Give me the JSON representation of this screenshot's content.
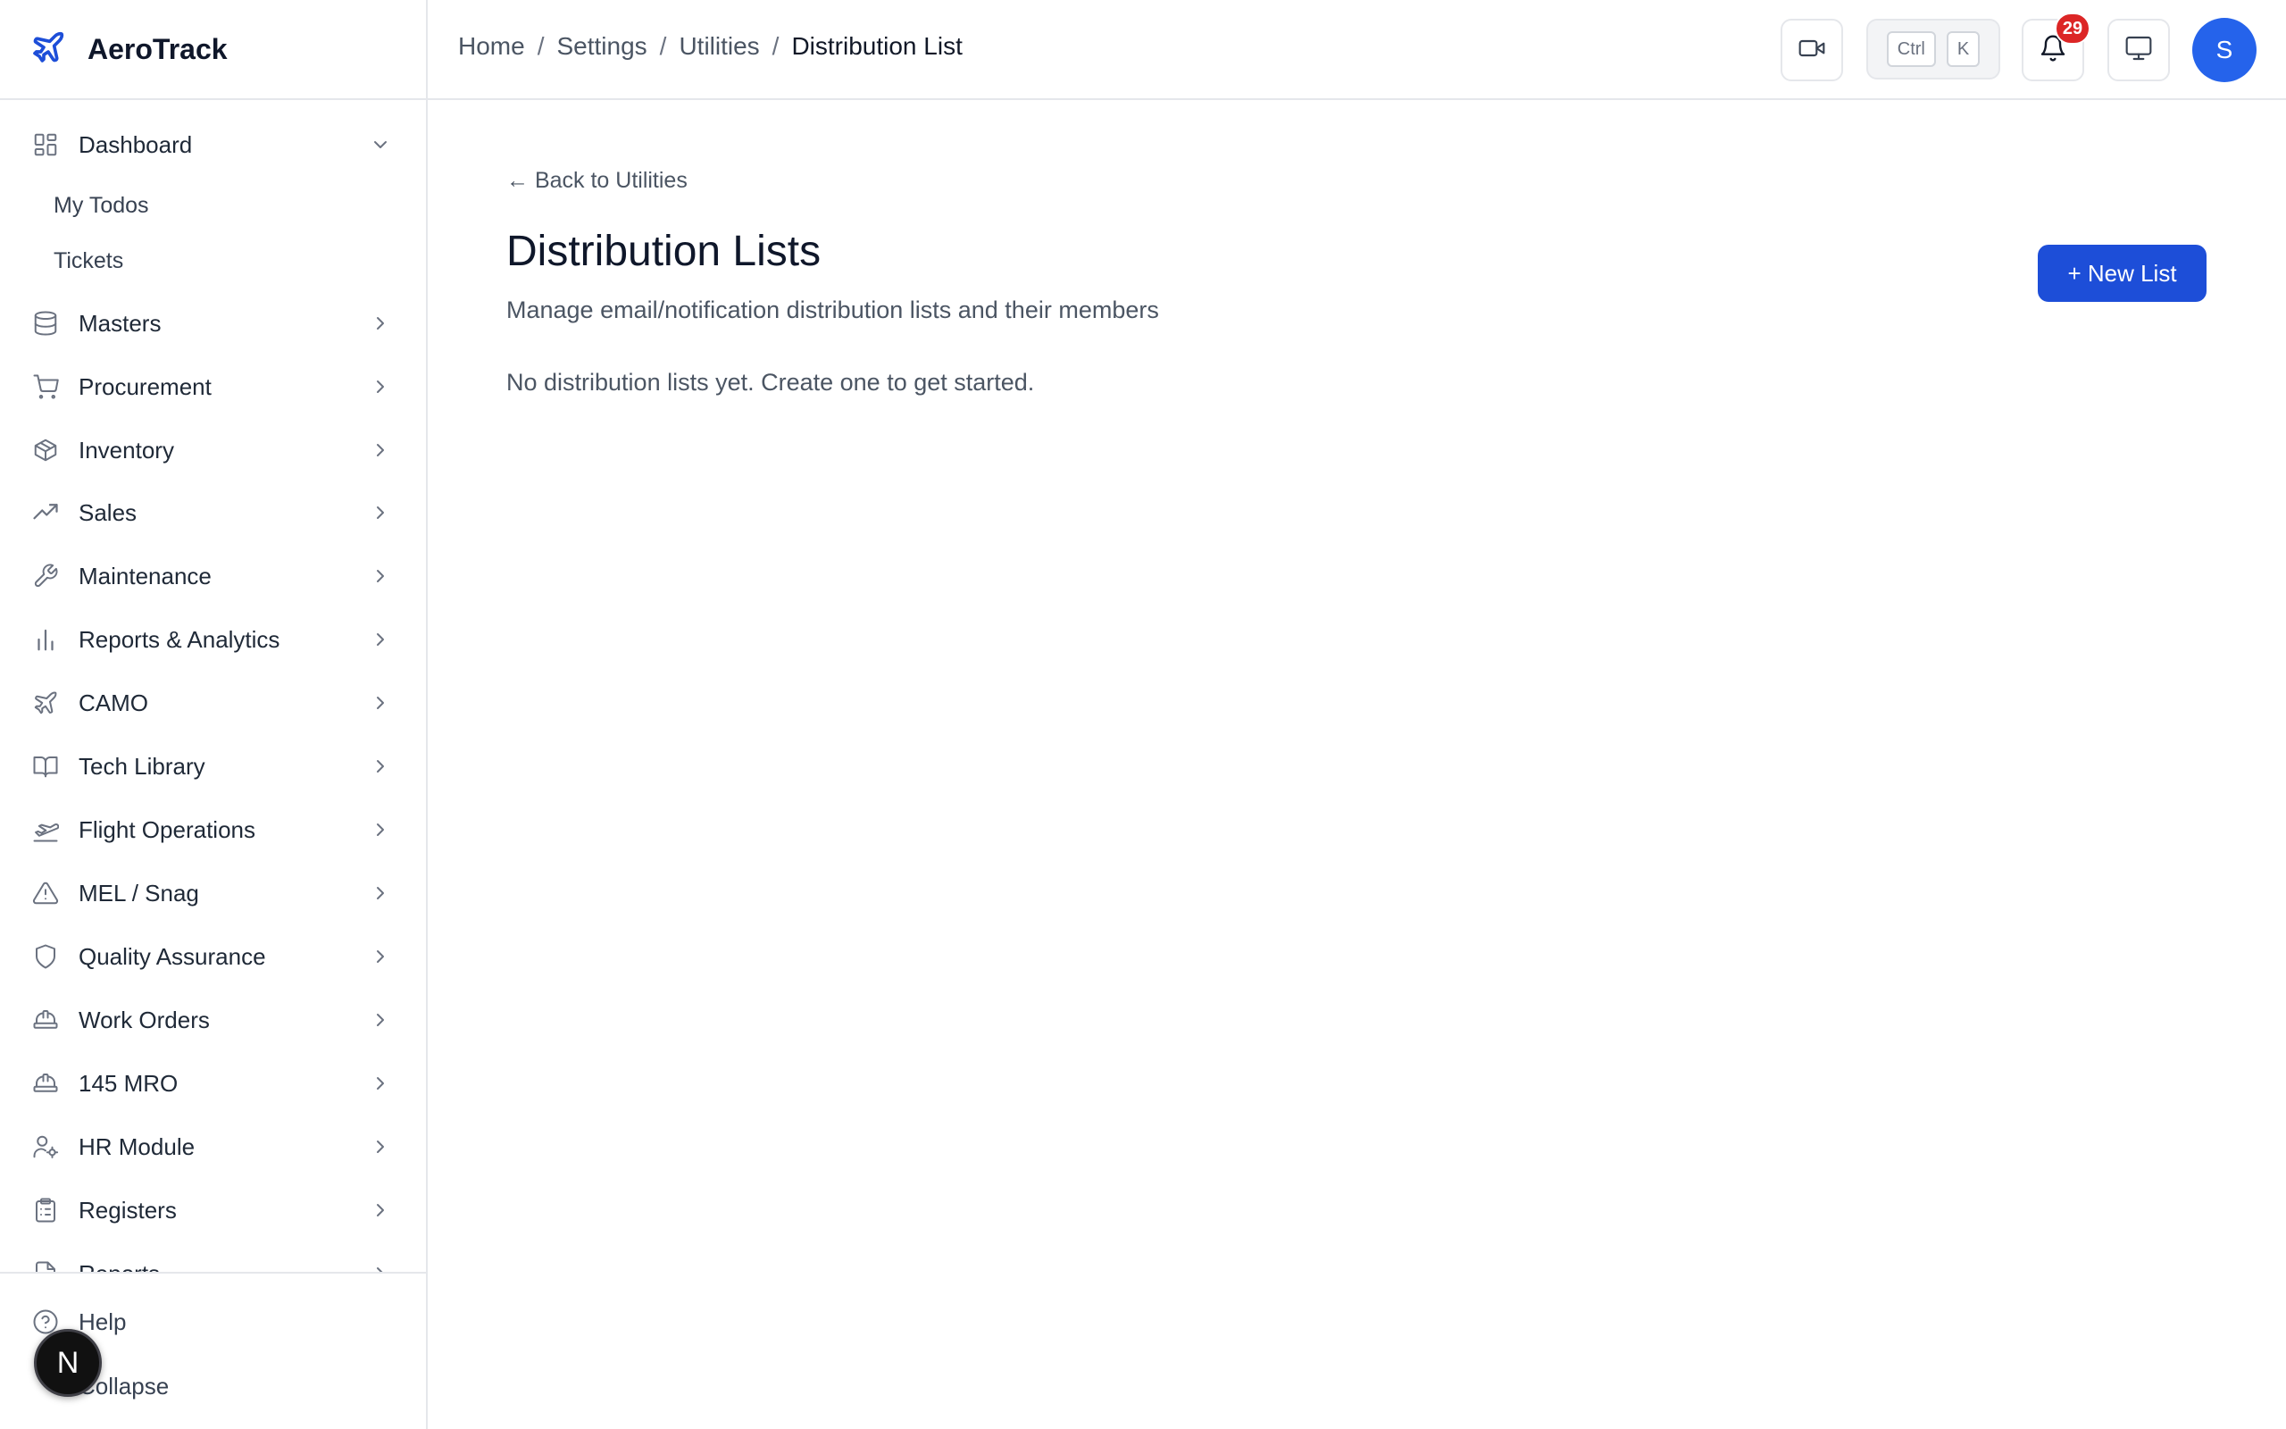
{
  "app": {
    "name": "AeroTrack",
    "brand_color": "#1d4ed8"
  },
  "breadcrumb": {
    "items": [
      "Home",
      "Settings",
      "Utilities"
    ],
    "current": "Distribution List",
    "separator": "/"
  },
  "topbar": {
    "shortcut": [
      "Ctrl",
      "K"
    ],
    "notification_count": "29",
    "avatar_initial": "S",
    "icons": [
      "video-icon",
      "bell-icon",
      "monitor-icon"
    ]
  },
  "sidebar": {
    "dashboard": {
      "label": "Dashboard",
      "icon": "layout-dashboard-icon",
      "expanded": true,
      "children": [
        "My Todos",
        "Tickets"
      ]
    },
    "items": [
      {
        "label": "Masters",
        "icon": "database-icon"
      },
      {
        "label": "Procurement",
        "icon": "cart-icon"
      },
      {
        "label": "Inventory",
        "icon": "package-icon"
      },
      {
        "label": "Sales",
        "icon": "trending-up-icon"
      },
      {
        "label": "Maintenance",
        "icon": "wrench-icon"
      },
      {
        "label": "Reports & Analytics",
        "icon": "bar-chart-icon"
      },
      {
        "label": "CAMO",
        "icon": "plane-icon"
      },
      {
        "label": "Tech Library",
        "icon": "book-open-icon"
      },
      {
        "label": "Flight Operations",
        "icon": "plane-takeoff-icon"
      },
      {
        "label": "MEL / Snag",
        "icon": "alert-triangle-icon"
      },
      {
        "label": "Quality Assurance",
        "icon": "shield-icon"
      },
      {
        "label": "Work Orders",
        "icon": "hard-hat-icon"
      },
      {
        "label": "145 MRO",
        "icon": "hard-hat-icon"
      },
      {
        "label": "HR Module",
        "icon": "user-cog-icon"
      },
      {
        "label": "Registers",
        "icon": "clipboard-list-icon"
      },
      {
        "label": "Reports",
        "icon": "file-icon"
      }
    ],
    "footer": {
      "help": "Help",
      "collapse": "Collapse"
    },
    "dev_badge": "N"
  },
  "main": {
    "back_link": "← Back to Utilities",
    "title": "Distribution Lists",
    "subtitle": "Manage email/notification distribution lists and their members",
    "empty_message": "No distribution lists yet. Create one to get started.",
    "new_list_button": "+ New List"
  }
}
